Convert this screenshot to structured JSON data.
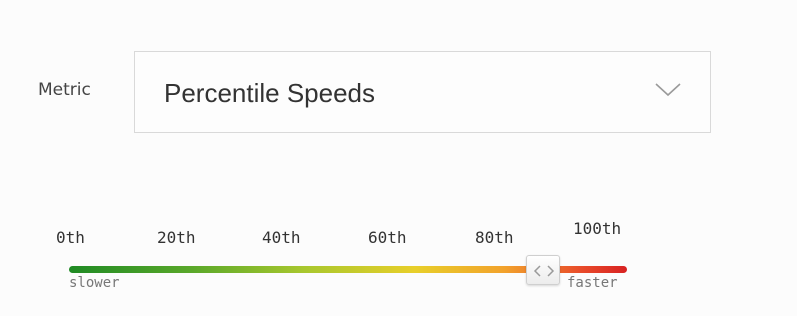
{
  "metric": {
    "label": "Metric",
    "selected": "Percentile Speeds",
    "chevron_icon": "chevron-down-icon"
  },
  "slider": {
    "ticks": [
      "0th",
      "20th",
      "40th",
      "60th",
      "80th",
      "100th"
    ],
    "value_fraction": 0.85,
    "min_label": "slower",
    "max_label": "faster",
    "handle_icon": "left-right-arrows-icon",
    "gradient_colors": [
      "#1f8a24",
      "#a8c72e",
      "#e8cf2a",
      "#f2a22c",
      "#d82222"
    ]
  }
}
